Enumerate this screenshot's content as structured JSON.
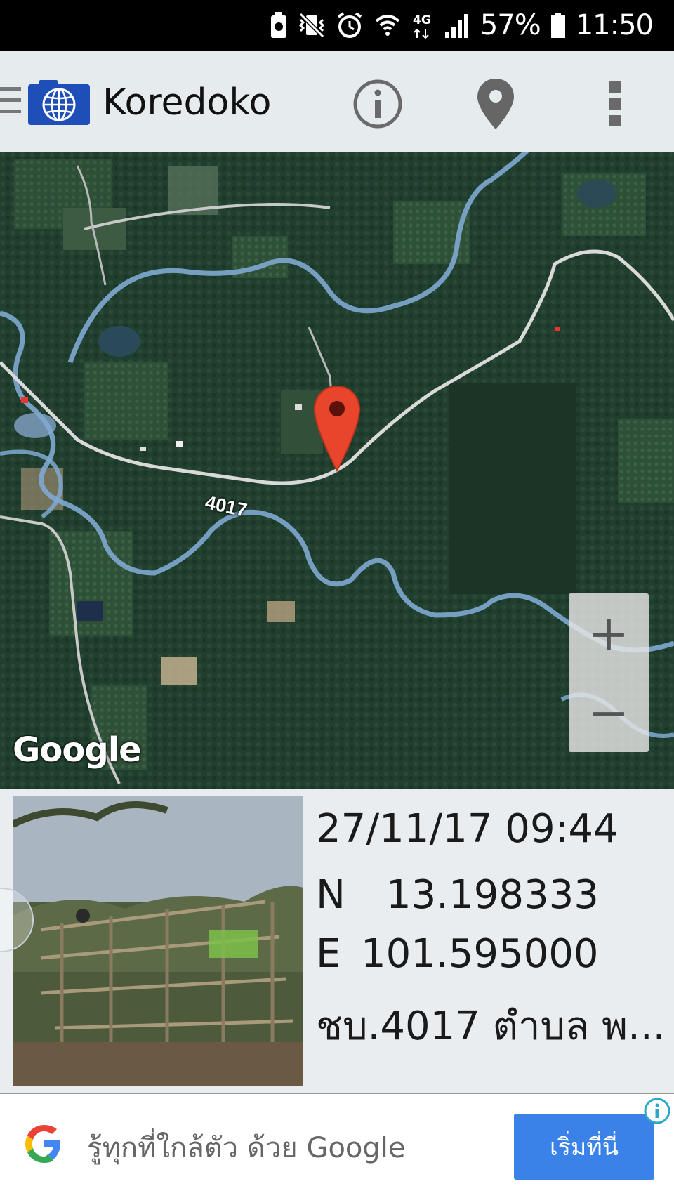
{
  "status_bar": {
    "battery_percent": "57%",
    "time": "11:50",
    "network": "4G"
  },
  "app_bar": {
    "title": "Koredoko",
    "icons": [
      "menu-icon",
      "globe-camera-icon",
      "info-icon",
      "location-pin-icon",
      "more-vert-icon"
    ]
  },
  "map": {
    "road_label": "4017",
    "provider_logo": "Google",
    "zoom_in_label": "+",
    "zoom_out_label": "−",
    "colors": {
      "forest": "#1f3d2d",
      "river": "#7fa9d1",
      "road": "#d9d9d9",
      "marker": "#e8452c"
    }
  },
  "photo_info": {
    "datetime": "27/11/17 09:44",
    "lat_axis": "N",
    "lat_value": "13.198333",
    "lng_axis": "E",
    "lng_value": "101.595000",
    "address": "ชบ.4017 ตำบล พ..."
  },
  "ad": {
    "text": "รู้ทุกที่ใกล้ตัว ด้วย  Google",
    "cta_label": "เริ่มที่นี่",
    "accent": "#3b82e8"
  }
}
